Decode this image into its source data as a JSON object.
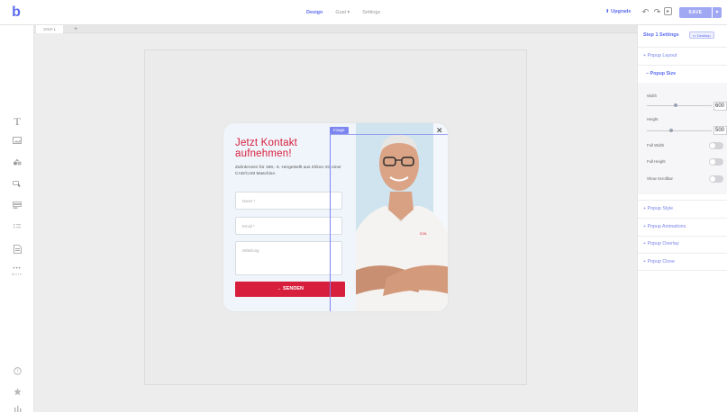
{
  "topbar": {
    "logo": "b",
    "tabs": [
      {
        "label": "Design",
        "active": true
      },
      {
        "label": "Goal ▾",
        "active": false
      },
      {
        "label": "Settings",
        "active": false
      }
    ],
    "upgrade": "⬆ Upgrade",
    "save_label": "SAVE"
  },
  "steps": {
    "tab": "STEP 1",
    "add": "+"
  },
  "lefttool": {
    "more_label": "More"
  },
  "popup": {
    "title": "Jetzt Kontakt aufnehmen!",
    "description": "Zahnkronen für 198,- €. Hergestellt aus Zirkon mit einer CAD/CAM Maschine.",
    "name_placeholder": "Name *",
    "email_placeholder": "Email *",
    "message_placeholder": "Mitteilung",
    "submit_label": "→ SENDEN",
    "image_label": "Image",
    "close": "✕"
  },
  "panel": {
    "header": "Step 1 Settings",
    "device": "▭ Desktop",
    "sections": {
      "layout": "+ Popup Layout",
      "size": "− Popup Size",
      "style": "+ Popup Style",
      "animations": "+ Popup Animations",
      "overlay": "+ Popup Overlay",
      "close": "+ Popup Close"
    },
    "width_label": "Width",
    "width_value": "600",
    "height_label": "Height",
    "height_value": "500",
    "full_width_label": "Full Width",
    "full_height_label": "Full Height",
    "scrollbar_label": "Show Scrollbar"
  },
  "colors": {
    "accent": "#5b6cf0",
    "brand_red": "#d71e3c"
  }
}
